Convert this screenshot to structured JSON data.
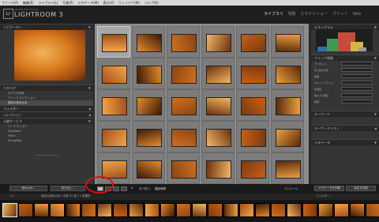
{
  "menubar": {
    "items": [
      "ファイル(F)",
      "編集(E)",
      "ライブラリ(L)",
      "写真(P)",
      "メタデータ(M)",
      "表示(V)",
      "ウィンドウ(W)",
      "ヘルプ(H)"
    ]
  },
  "identity": {
    "logo": "Lr",
    "subtitle": "ADOBE PHOTOSHOP",
    "title": "LIGHTROOM 3",
    "modules": [
      {
        "label": "ライブラリ",
        "active": true
      },
      {
        "label": "現像",
        "active": false
      },
      {
        "label": "スライドショー",
        "active": false
      },
      {
        "label": "プリント",
        "active": false
      },
      {
        "label": "Web",
        "active": false
      }
    ]
  },
  "left": {
    "navigator": "ナビゲーター",
    "catalog": "カタログ",
    "catalog_items": [
      {
        "label": "すべての写真"
      },
      {
        "label": "クイックコレクション"
      },
      {
        "label": "前回の読み込み",
        "selected": true
      }
    ],
    "folders": "フォルダー",
    "collections": "コレクション",
    "publish_services": "公開サービス",
    "publish_items": [
      "ハードディスク",
      "Facebook",
      "Flickr",
      "SmugMug"
    ]
  },
  "right": {
    "histogram": "ヒストグラム",
    "quick_develop": "クイック現像",
    "rows": [
      "プリセット",
      "切り抜き比率",
      "処理",
      "ホワイトバランス",
      "色温度",
      "色かぶり補正",
      "階調"
    ],
    "keywords": "キーワード",
    "keyword_list": "キーワードリスト",
    "metadata": "メタデータ"
  },
  "toolbar": {
    "import": "読み込み...",
    "export": "書き出し...",
    "sort_label": "並べ替え：",
    "sort_value": "撮影時間",
    "thumbnails": "サムネール",
    "sync_metadata": "メタデータを同期",
    "sync_settings": "設定を同期"
  },
  "filmbar": {
    "pages": "1  2",
    "path": "前回の読み込み  /  写真 30 枚  /  1 枚選択",
    "filter": "フィルター："
  },
  "colors": {
    "accent_circle": "#d8121a",
    "cat_orange": "#e08a2a"
  },
  "icons": [
    "grid-view-icon",
    "loupe-view-icon",
    "compare-view-icon",
    "survey-view-icon",
    "spray-can-icon",
    "collapse-triangle-icon"
  ]
}
